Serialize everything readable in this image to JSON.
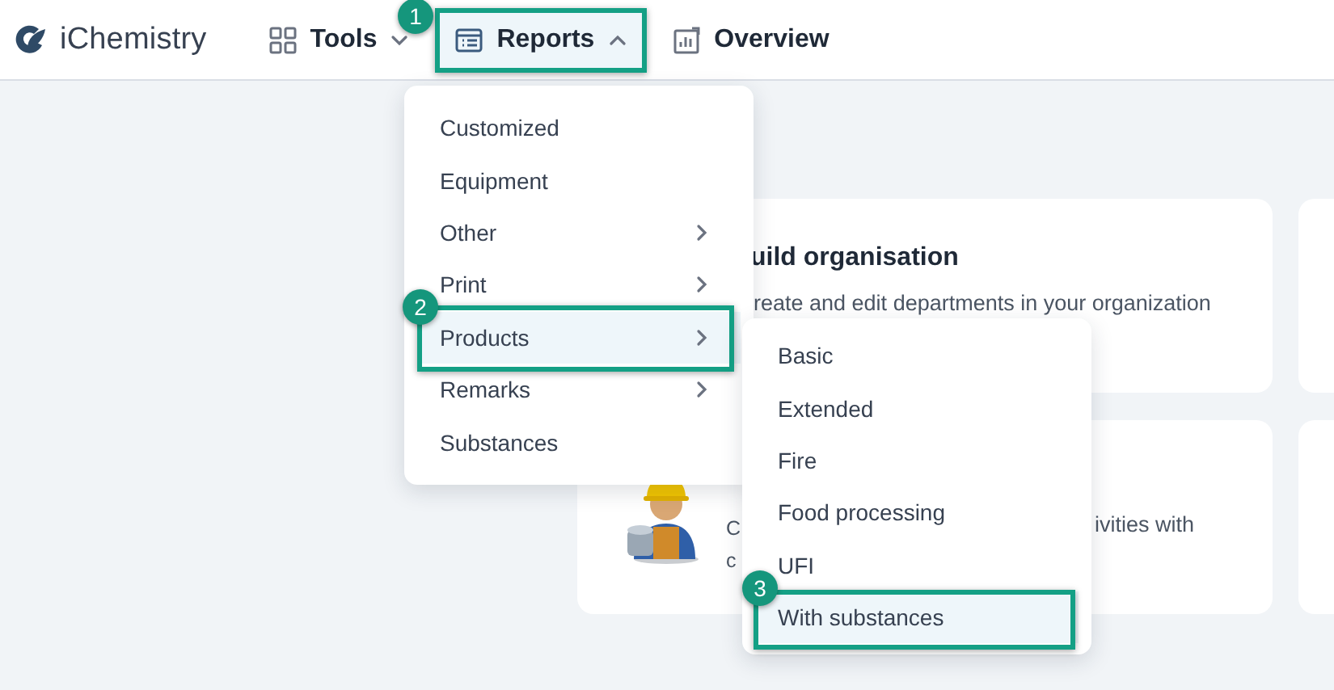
{
  "brand": {
    "name": "iChemistry"
  },
  "nav": [
    {
      "kind": "grid",
      "label": "Tools",
      "dropdown": true,
      "expanded": false
    },
    {
      "kind": "report",
      "label": "Reports",
      "dropdown": true,
      "expanded": true,
      "callout": "1"
    },
    {
      "kind": "chart",
      "label": "Overview",
      "dropdown": false,
      "expanded": false
    }
  ],
  "menu": {
    "items": [
      {
        "label": "Customized",
        "submenu": false,
        "selected": false
      },
      {
        "label": "Equipment",
        "submenu": false,
        "selected": false
      },
      {
        "label": "Other",
        "submenu": true,
        "selected": false
      },
      {
        "label": "Print",
        "submenu": true,
        "selected": false
      },
      {
        "label": "Products",
        "submenu": true,
        "selected": true,
        "callout": "2"
      },
      {
        "label": "Remarks",
        "submenu": true,
        "selected": false
      },
      {
        "label": "Substances",
        "submenu": false,
        "selected": false
      }
    ]
  },
  "submenu": {
    "items": [
      {
        "label": "Basic",
        "selected": false
      },
      {
        "label": "Extended",
        "selected": false
      },
      {
        "label": "Fire",
        "selected": false
      },
      {
        "label": "Food processing",
        "selected": false
      },
      {
        "label": "UFI",
        "selected": false
      },
      {
        "label": "With substances",
        "selected": true,
        "callout": "3"
      }
    ]
  },
  "cards": [
    {
      "kind": "text",
      "title": "uild organisation",
      "description": "reate and edit departments in your organization"
    },
    {
      "kind": "blank"
    },
    {
      "kind": "worker",
      "description_left": [
        "C",
        "c"
      ],
      "description_right": "ivities with"
    },
    {
      "kind": "blank"
    }
  ]
}
